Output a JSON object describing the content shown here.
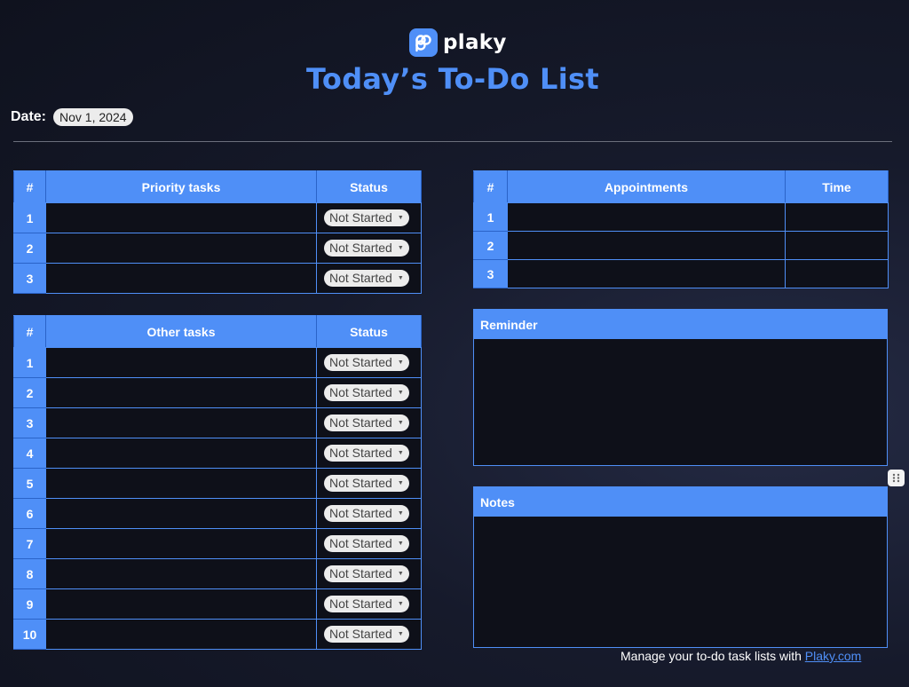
{
  "brand": {
    "name": "plaky",
    "accent": "#4f8ff7",
    "icon": "plaky-logo-icon"
  },
  "title": "Today’s To-Do List",
  "date": {
    "label": "Date:",
    "value": "Nov 1, 2024"
  },
  "priority_table": {
    "headers": [
      "#",
      "Priority tasks",
      "Status"
    ],
    "rows": [
      {
        "num": "1",
        "task": "",
        "status": "Not Started"
      },
      {
        "num": "2",
        "task": "",
        "status": "Not Started"
      },
      {
        "num": "3",
        "task": "",
        "status": "Not Started"
      }
    ]
  },
  "other_table": {
    "headers": [
      "#",
      "Other tasks",
      "Status"
    ],
    "rows": [
      {
        "num": "1",
        "task": "",
        "status": "Not Started"
      },
      {
        "num": "2",
        "task": "",
        "status": "Not Started"
      },
      {
        "num": "3",
        "task": "",
        "status": "Not Started"
      },
      {
        "num": "4",
        "task": "",
        "status": "Not Started"
      },
      {
        "num": "5",
        "task": "",
        "status": "Not Started"
      },
      {
        "num": "6",
        "task": "",
        "status": "Not Started"
      },
      {
        "num": "7",
        "task": "",
        "status": "Not Started"
      },
      {
        "num": "8",
        "task": "",
        "status": "Not Started"
      },
      {
        "num": "9",
        "task": "",
        "status": "Not Started"
      },
      {
        "num": "10",
        "task": "",
        "status": "Not Started"
      }
    ]
  },
  "appointments_table": {
    "headers": [
      "#",
      "Appointments",
      "Time"
    ],
    "rows": [
      {
        "num": "1",
        "appointment": "",
        "time": ""
      },
      {
        "num": "2",
        "appointment": "",
        "time": ""
      },
      {
        "num": "3",
        "appointment": "",
        "time": ""
      }
    ]
  },
  "reminder": {
    "title": "Reminder",
    "body": ""
  },
  "notes": {
    "title": "Notes",
    "body": ""
  },
  "footer": {
    "text": "Manage your to-do task lists with ",
    "link": "Plaky.com"
  }
}
